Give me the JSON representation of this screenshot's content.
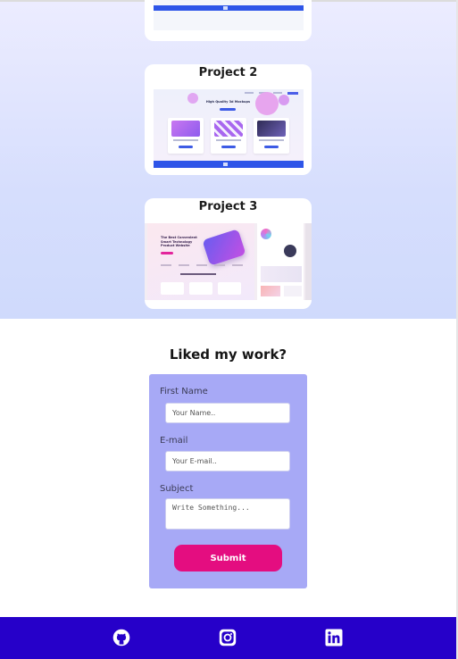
{
  "projects": [
    {
      "title": ""
    },
    {
      "title": "Project 2",
      "hero_text": "High Quality 3d Mockups"
    },
    {
      "title": "Project 3",
      "hero_text": "The Best Convenient Smart Technology Product Website"
    }
  ],
  "contact": {
    "title": "Liked my work?",
    "first_name_label": "First Name",
    "first_name_placeholder": "Your Name..",
    "email_label": "E-mail",
    "email_placeholder": "Your E-mail..",
    "subject_label": "Subject",
    "subject_placeholder": "Write Something...",
    "submit_label": "Submit"
  },
  "footer": {
    "links": [
      {
        "icon": "github-icon"
      },
      {
        "icon": "instagram-icon"
      },
      {
        "icon": "linkedin-icon"
      }
    ]
  },
  "colors": {
    "form_bg": "#a7a9f6",
    "submit_bg": "#e40d80",
    "footer_bg": "#2600c9",
    "hero_gradient_top": "#ececff",
    "hero_gradient_bottom": "#cfdafc"
  }
}
